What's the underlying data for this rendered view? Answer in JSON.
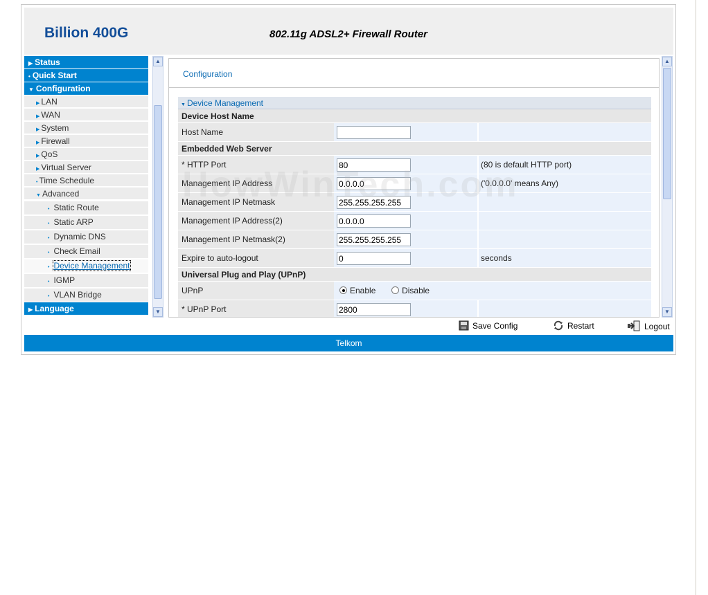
{
  "header": {
    "brand": "Billion 400G",
    "subtitle": "802.11g ADSL2+ Firewall Router"
  },
  "nav": {
    "status": "Status",
    "quick_start": "Quick Start",
    "configuration": "Configuration",
    "lan": "LAN",
    "wan": "WAN",
    "system": "System",
    "firewall": "Firewall",
    "qos": "QoS",
    "virtual_server": "Virtual Server",
    "time_schedule": "Time Schedule",
    "advanced": "Advanced",
    "static_route": "Static Route",
    "static_arp": "Static ARP",
    "dynamic_dns": "Dynamic DNS",
    "check_email": "Check Email",
    "device_management": "Device Management",
    "igmp": "IGMP",
    "vlan_bridge": "VLAN Bridge",
    "language": "Language"
  },
  "content": {
    "breadcrumb": "Configuration",
    "panel_title": "Device Management",
    "sections": {
      "host": "Device Host Name",
      "web": "Embedded Web Server",
      "upnp": "Universal Plug and Play (UPnP)"
    },
    "rows": {
      "host_name": {
        "label": "Host Name",
        "value": ""
      },
      "http_port": {
        "label": "* HTTP Port",
        "value": "80",
        "note": "(80 is default HTTP port)"
      },
      "mgmt_ip": {
        "label": "Management IP Address",
        "value": "0.0.0.0",
        "note": "('0.0.0.0' means Any)"
      },
      "mgmt_mask": {
        "label": "Management IP Netmask",
        "value": "255.255.255.255"
      },
      "mgmt_ip2": {
        "label": "Management IP Address(2)",
        "value": "0.0.0.0"
      },
      "mgmt_mask2": {
        "label": "Management IP Netmask(2)",
        "value": "255.255.255.255"
      },
      "expire": {
        "label": "Expire to auto-logout",
        "value": "0",
        "note": "seconds"
      },
      "upnp": {
        "label": "UPnP",
        "enable": "Enable",
        "disable": "Disable",
        "selected": "Enable"
      },
      "upnp_port": {
        "label": "* UPnP Port",
        "value": "2800"
      }
    }
  },
  "actions": {
    "save": "Save Config",
    "restart": "Restart",
    "logout": "Logout"
  },
  "footer": {
    "text": "Telkom"
  },
  "watermark": "HowWinTech.com",
  "colors": {
    "nav_blue": "#0083cf",
    "brand_blue": "#134e99",
    "link_blue": "#0b6bb3"
  }
}
